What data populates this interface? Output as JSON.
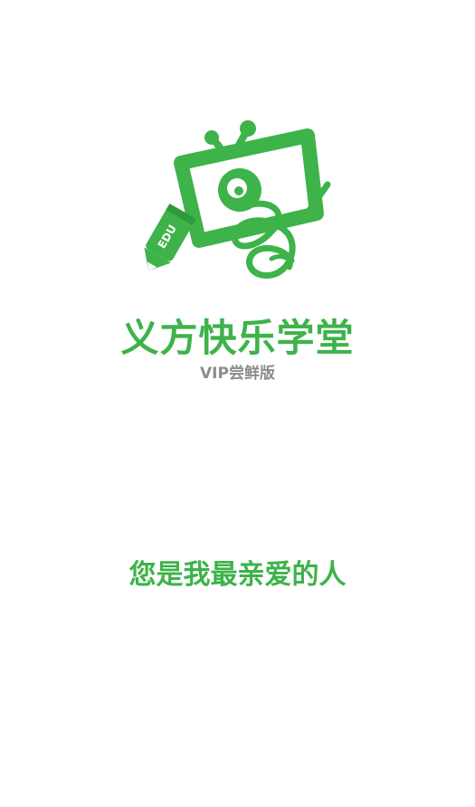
{
  "splash": {
    "logo": {
      "icon": "tv-mascot-pencil-logo",
      "badge_text": "EDU"
    },
    "app_name": "义方快乐学堂",
    "edition": "VIP尝鲜版",
    "slogan": "您是我最亲爱的人"
  },
  "colors": {
    "brand_green": "#3DB34A",
    "edition_gray": "#8C8C8C",
    "background": "#FFFFFF"
  }
}
